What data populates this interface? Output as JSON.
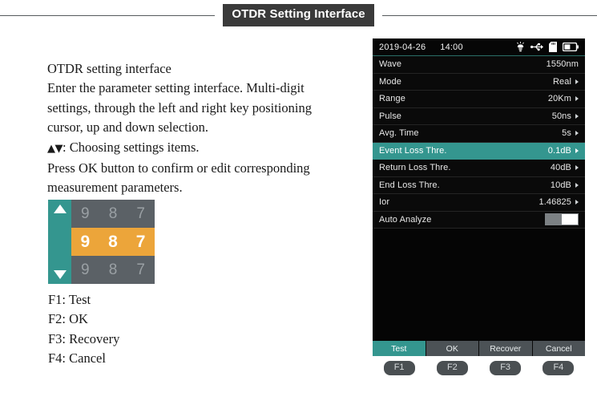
{
  "header": {
    "title": "OTDR Setting Interface"
  },
  "description": {
    "lines": [
      "OTDR setting interface",
      "Enter the parameter setting interface. Multi-digit",
      "settings, through the left and right key positioning",
      "cursor, up and down selection.",
      "▲▼: Choosing settings items.",
      "Press OK button to confirm or edit corresponding",
      "measurement parameters."
    ],
    "line1": "OTDR setting interface",
    "line2": "Enter the parameter setting interface. Multi-digit",
    "line3": "settings, through the left and right key positioning",
    "line4": "cursor, up and down selection.",
    "line5_glyphs": "▲▼",
    "line5_text": ": Choosing settings items.",
    "line6": "Press OK button to confirm or edit corresponding",
    "line7": "measurement parameters."
  },
  "spinner": {
    "up_icon": "triangle-up-icon",
    "down_icon": "triangle-down-icon",
    "rows": [
      {
        "digits": [
          "9",
          "8",
          "7"
        ],
        "highlighted": false
      },
      {
        "digits": [
          "9",
          "8",
          "7"
        ],
        "highlighted": true
      },
      {
        "digits": [
          "9",
          "8",
          "7"
        ],
        "highlighted": false
      }
    ],
    "highlight_color": "#eca53a",
    "arrow_column_color": "#34968f",
    "body_color": "#5b6166"
  },
  "fkey_legend": [
    "F1: Test",
    "F2: OK",
    "F3: Recovery",
    "F4: Cancel"
  ],
  "device": {
    "statusbar": {
      "date": "2019-04-26",
      "time": "14:00",
      "icons": [
        "lamp-icon",
        "usb-icon",
        "sd-card-icon",
        "battery-icon"
      ]
    },
    "settings": [
      {
        "label": "Wave",
        "value": "1550nm",
        "caret": false,
        "selected": false,
        "toggle": null
      },
      {
        "label": "Mode",
        "value": "Real",
        "caret": true,
        "selected": false,
        "toggle": null
      },
      {
        "label": "Range",
        "value": "20Km",
        "caret": true,
        "selected": false,
        "toggle": null
      },
      {
        "label": "Pulse",
        "value": "50ns",
        "caret": true,
        "selected": false,
        "toggle": null
      },
      {
        "label": "Avg. Time",
        "value": "5s",
        "caret": true,
        "selected": false,
        "toggle": null
      },
      {
        "label": "Event Loss Thre.",
        "value": "0.1dB",
        "caret": true,
        "selected": true,
        "toggle": null
      },
      {
        "label": "Return Loss Thre.",
        "value": "40dB",
        "caret": true,
        "selected": false,
        "toggle": null
      },
      {
        "label": "End Loss Thre.",
        "value": "10dB",
        "caret": true,
        "selected": false,
        "toggle": null
      },
      {
        "label": "Ior",
        "value": "1.46825",
        "caret": true,
        "selected": false,
        "toggle": null
      },
      {
        "label": "Auto Analyze",
        "value": "",
        "caret": false,
        "selected": false,
        "toggle": "on"
      }
    ],
    "softkeys": [
      {
        "label": "Test",
        "active": true
      },
      {
        "label": "OK",
        "active": false
      },
      {
        "label": "Recover",
        "active": false
      },
      {
        "label": "Cancel",
        "active": false
      }
    ],
    "fkeys": [
      "F1",
      "F2",
      "F3",
      "F4"
    ],
    "accent_color": "#34968f",
    "screen_bg": "#050505"
  }
}
